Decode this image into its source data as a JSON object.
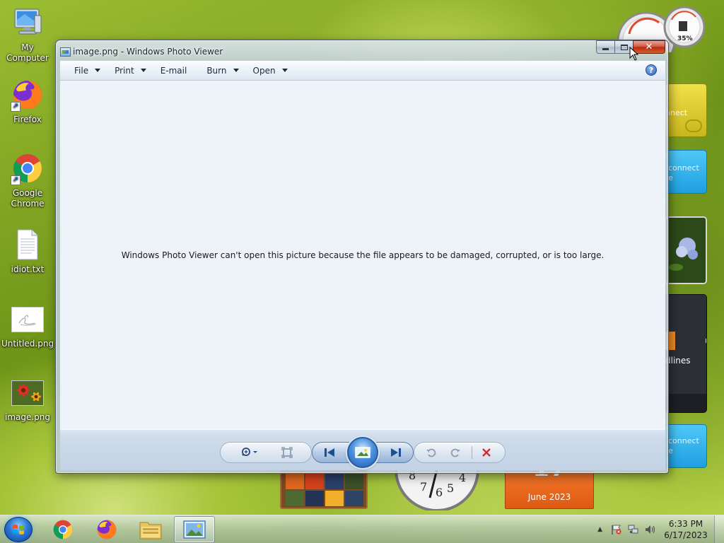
{
  "desktop": {
    "icons": [
      {
        "label": "My Computer"
      },
      {
        "label": "Firefox"
      },
      {
        "label": "Google Chrome"
      },
      {
        "label": "idiot.txt"
      },
      {
        "label": "Untitled.png"
      },
      {
        "label": "image.png"
      }
    ]
  },
  "gadgets": {
    "cpu_meter_value": "35%",
    "feed_tile_1": "nnect",
    "feed_tile_2_line1": "connect",
    "feed_tile_2_line2": "e",
    "headlines_tile": "dlines",
    "headlines_fragment": "n",
    "feed_tile_3_line1": "connect",
    "feed_tile_3_line2": "e",
    "calendar_day": "17",
    "calendar_month": "June 2023"
  },
  "window": {
    "title": "image.png - Windows Photo Viewer",
    "menu": [
      {
        "label": "File",
        "has_dropdown": true
      },
      {
        "label": "Print",
        "has_dropdown": true
      },
      {
        "label": "E-mail",
        "has_dropdown": false
      },
      {
        "label": "Burn",
        "has_dropdown": true
      },
      {
        "label": "Open",
        "has_dropdown": true
      }
    ],
    "help_glyph": "?",
    "message": "Windows Photo Viewer can't open this picture because the file appears to be damaged, corrupted, or is too large."
  },
  "taskbar": {
    "pinned": [
      "Start",
      "Google Chrome",
      "Firefox",
      "Windows Explorer",
      "Windows Photo Viewer"
    ],
    "clock_time": "6:33 PM",
    "clock_date": "6/17/2023"
  },
  "colors": {
    "close_button": "#c4401f",
    "accent_blue": "#2b79d6",
    "delete_red": "#d42a2a",
    "calendar_orange": "#e8641c"
  }
}
